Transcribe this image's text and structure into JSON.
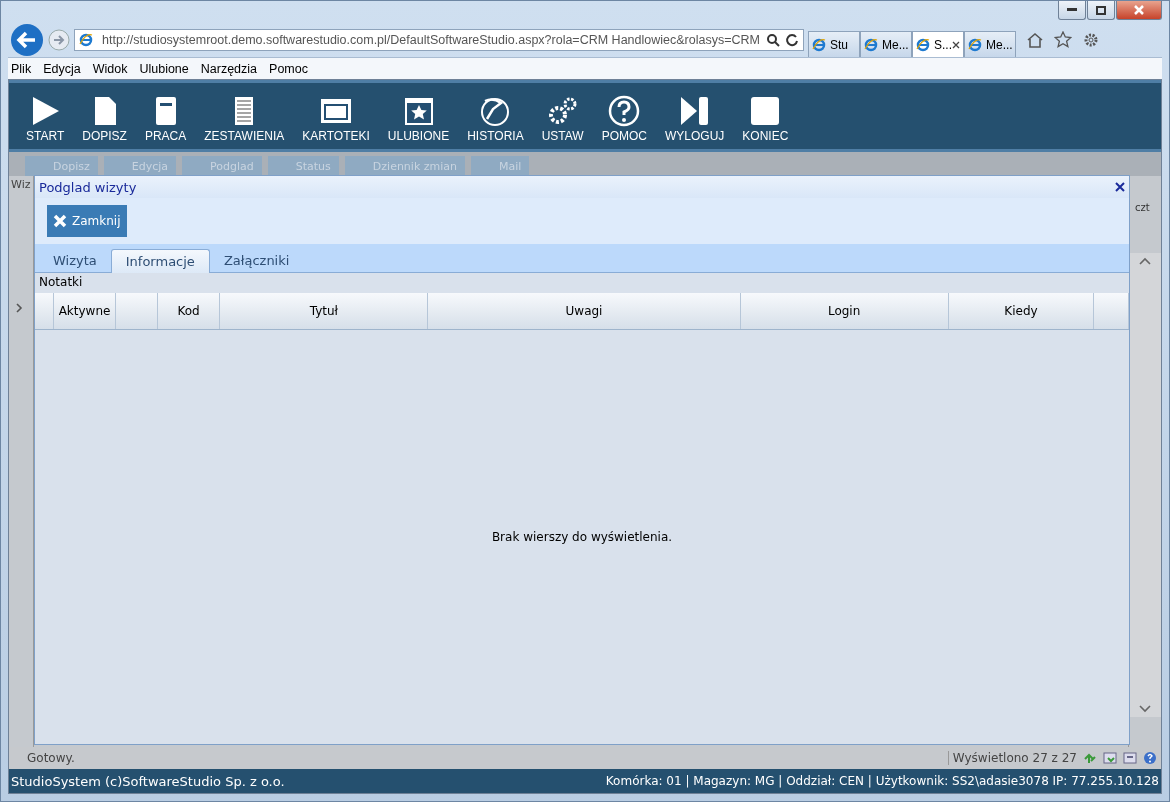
{
  "browser": {
    "url": "http://studiosystemroot.demo.softwarestudio.com.pl/DefaultSoftwareStudio.aspx?rola=CRM Handlowiec&rolasys=CRM",
    "tabs": [
      {
        "label": "Stu",
        "selected": false
      },
      {
        "label": "Me...",
        "selected": false
      },
      {
        "label": "S...",
        "selected": true
      },
      {
        "label": "Me...",
        "selected": false
      }
    ],
    "menu": [
      "Plik",
      "Edycja",
      "Widok",
      "Ulubione",
      "Narzędzia",
      "Pomoc"
    ]
  },
  "toolbar": [
    {
      "label": "START"
    },
    {
      "label": "DOPISZ"
    },
    {
      "label": "PRACA"
    },
    {
      "label": "ZESTAWIENIA"
    },
    {
      "label": "KARTOTEKI"
    },
    {
      "label": "ULUBIONE"
    },
    {
      "label": "HISTORIA"
    },
    {
      "label": "USTAW"
    },
    {
      "label": "POMOC"
    },
    {
      "label": "WYLOGUJ"
    },
    {
      "label": "KONIEC"
    }
  ],
  "sub_toolbar": [
    {
      "label": "Dopisz",
      "disabled": true
    },
    {
      "label": "Edycja",
      "disabled": true
    },
    {
      "label": "Podglad",
      "disabled": true
    },
    {
      "label": "Status",
      "disabled": true
    },
    {
      "label": "Dziennik zmian",
      "disabled": true
    },
    {
      "label": "Mail",
      "disabled": true
    }
  ],
  "background_grid": {
    "column_1": "Wiz",
    "column_2": "czt"
  },
  "dialog": {
    "title": "Podglad wizyty",
    "close_button": "Zamknij",
    "tabs": [
      {
        "label": "Wizyta",
        "selected": false
      },
      {
        "label": "Informacje",
        "selected": true
      },
      {
        "label": "Załączniki",
        "selected": false
      }
    ],
    "section": "Notatki",
    "columns": [
      {
        "kind": "blank"
      },
      {
        "kind": "text",
        "label": "Aktywne"
      },
      {
        "kind": "blank"
      },
      {
        "kind": "text",
        "label": "Kod"
      },
      {
        "kind": "text",
        "label": "Tytuł"
      },
      {
        "kind": "text",
        "label": "Uwagi"
      },
      {
        "kind": "text",
        "label": "Login"
      },
      {
        "kind": "text",
        "label": "Kiedy"
      },
      {
        "kind": "blank"
      }
    ],
    "empty_message": "Brak wierszy do wyświetlenia."
  },
  "status_bar": {
    "left": "Gotowy.",
    "right": "Wyświetlono 27 z 27"
  },
  "footer": {
    "left": "StudioSystem (c)SoftwareStudio Sp. z o.o.",
    "right": "Komórka: 01 | Magazyn: MG | Oddział: CEN | Użytkownik: SS2\\adasie3078 IP: 77.255.10.128"
  }
}
